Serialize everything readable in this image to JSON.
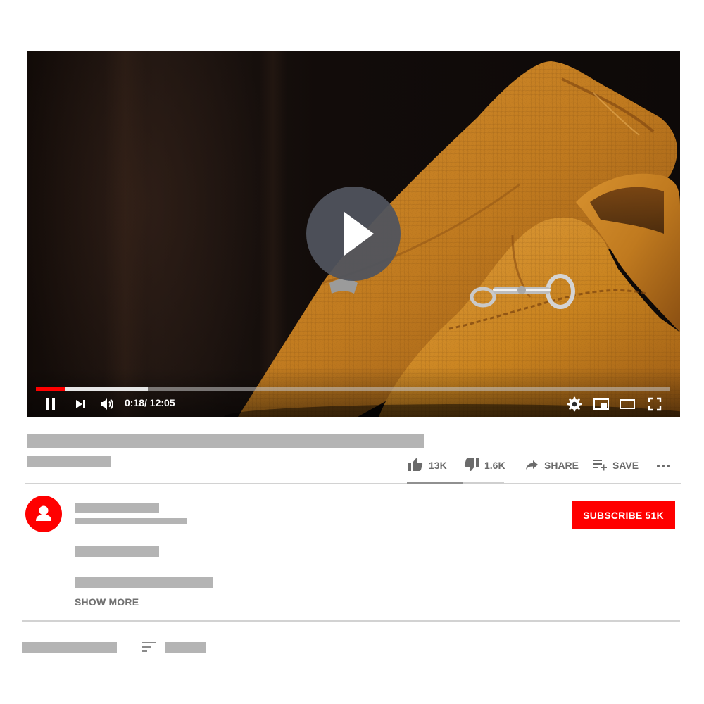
{
  "player": {
    "time": "0:18/ 12:05",
    "progress_played": 0.046,
    "progress_buffered": 0.177,
    "controls": [
      "pause-icon",
      "skip-next-icon",
      "volume-icon",
      "settings-icon",
      "miniplayer-icon",
      "theater-mode-icon",
      "fullscreen-icon"
    ],
    "big_play_icon": "play-icon",
    "accent_color": "#ff0000"
  },
  "actions": {
    "like": {
      "icon": "thumbs-up-icon",
      "label": "13K"
    },
    "dislike": {
      "icon": "thumbs-down-icon",
      "label": "1.6K"
    },
    "share": {
      "icon": "share-icon",
      "label": "SHARE"
    },
    "save": {
      "icon": "playlist-add-icon",
      "label": "SAVE"
    },
    "more": {
      "icon": "more-icon"
    },
    "like_ratio": 0.57
  },
  "channel": {
    "avatar_icon": "user-icon",
    "subscribe_label": "SUBSCRIBE 51K"
  },
  "description": {
    "show_more_label": "SHOW MORE"
  },
  "comments": {
    "sort_icon": "sort-icon"
  }
}
